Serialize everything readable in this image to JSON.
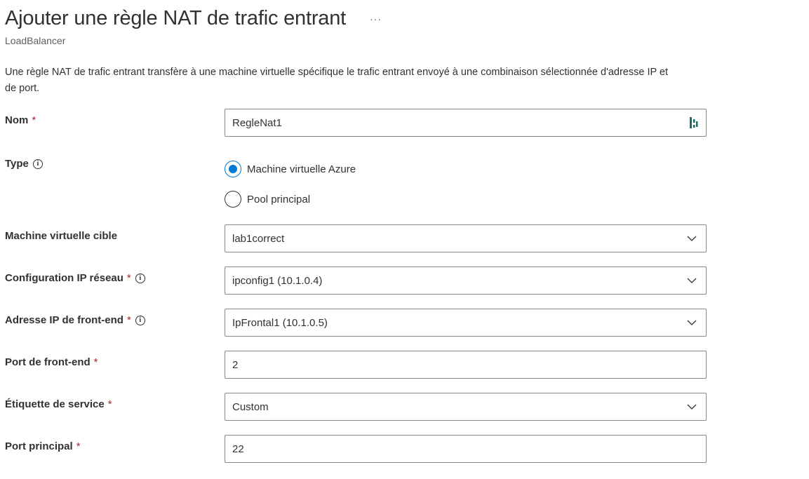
{
  "header": {
    "title": "Ajouter une règle NAT de trafic entrant",
    "more_label": "···",
    "subtitle": "LoadBalancer"
  },
  "description": "Une règle NAT de trafic entrant transfère à une machine virtuelle spécifique le trafic entrant envoyé à une combinaison sélectionnée d'adresse IP et de port.",
  "required_mark": "*",
  "info_glyph": "i",
  "colors": {
    "accent": "#0078d4",
    "required": "#a4262c",
    "text": "#323130",
    "secondary_text": "#605e5c",
    "border": "#8a8886"
  },
  "form": {
    "name": {
      "label": "Nom",
      "value": "RegleNat1",
      "icon": "password-manager-icon"
    },
    "type": {
      "label": "Type",
      "options": [
        {
          "label": "Machine virtuelle Azure",
          "checked": true
        },
        {
          "label": "Pool principal",
          "checked": false
        }
      ]
    },
    "target_vm": {
      "label": "Machine virtuelle cible",
      "value": "lab1correct"
    },
    "ip_config": {
      "label": "Configuration IP réseau",
      "value": "ipconfig1 (10.1.0.4)"
    },
    "frontend_ip": {
      "label": "Adresse IP de front-end",
      "value": "IpFrontal1 (10.1.0.5)"
    },
    "frontend_port": {
      "label": "Port de front-end",
      "value": "2"
    },
    "service_tag": {
      "label": "Étiquette de service",
      "value": "Custom"
    },
    "backend_port": {
      "label": "Port principal",
      "value": "22"
    }
  }
}
